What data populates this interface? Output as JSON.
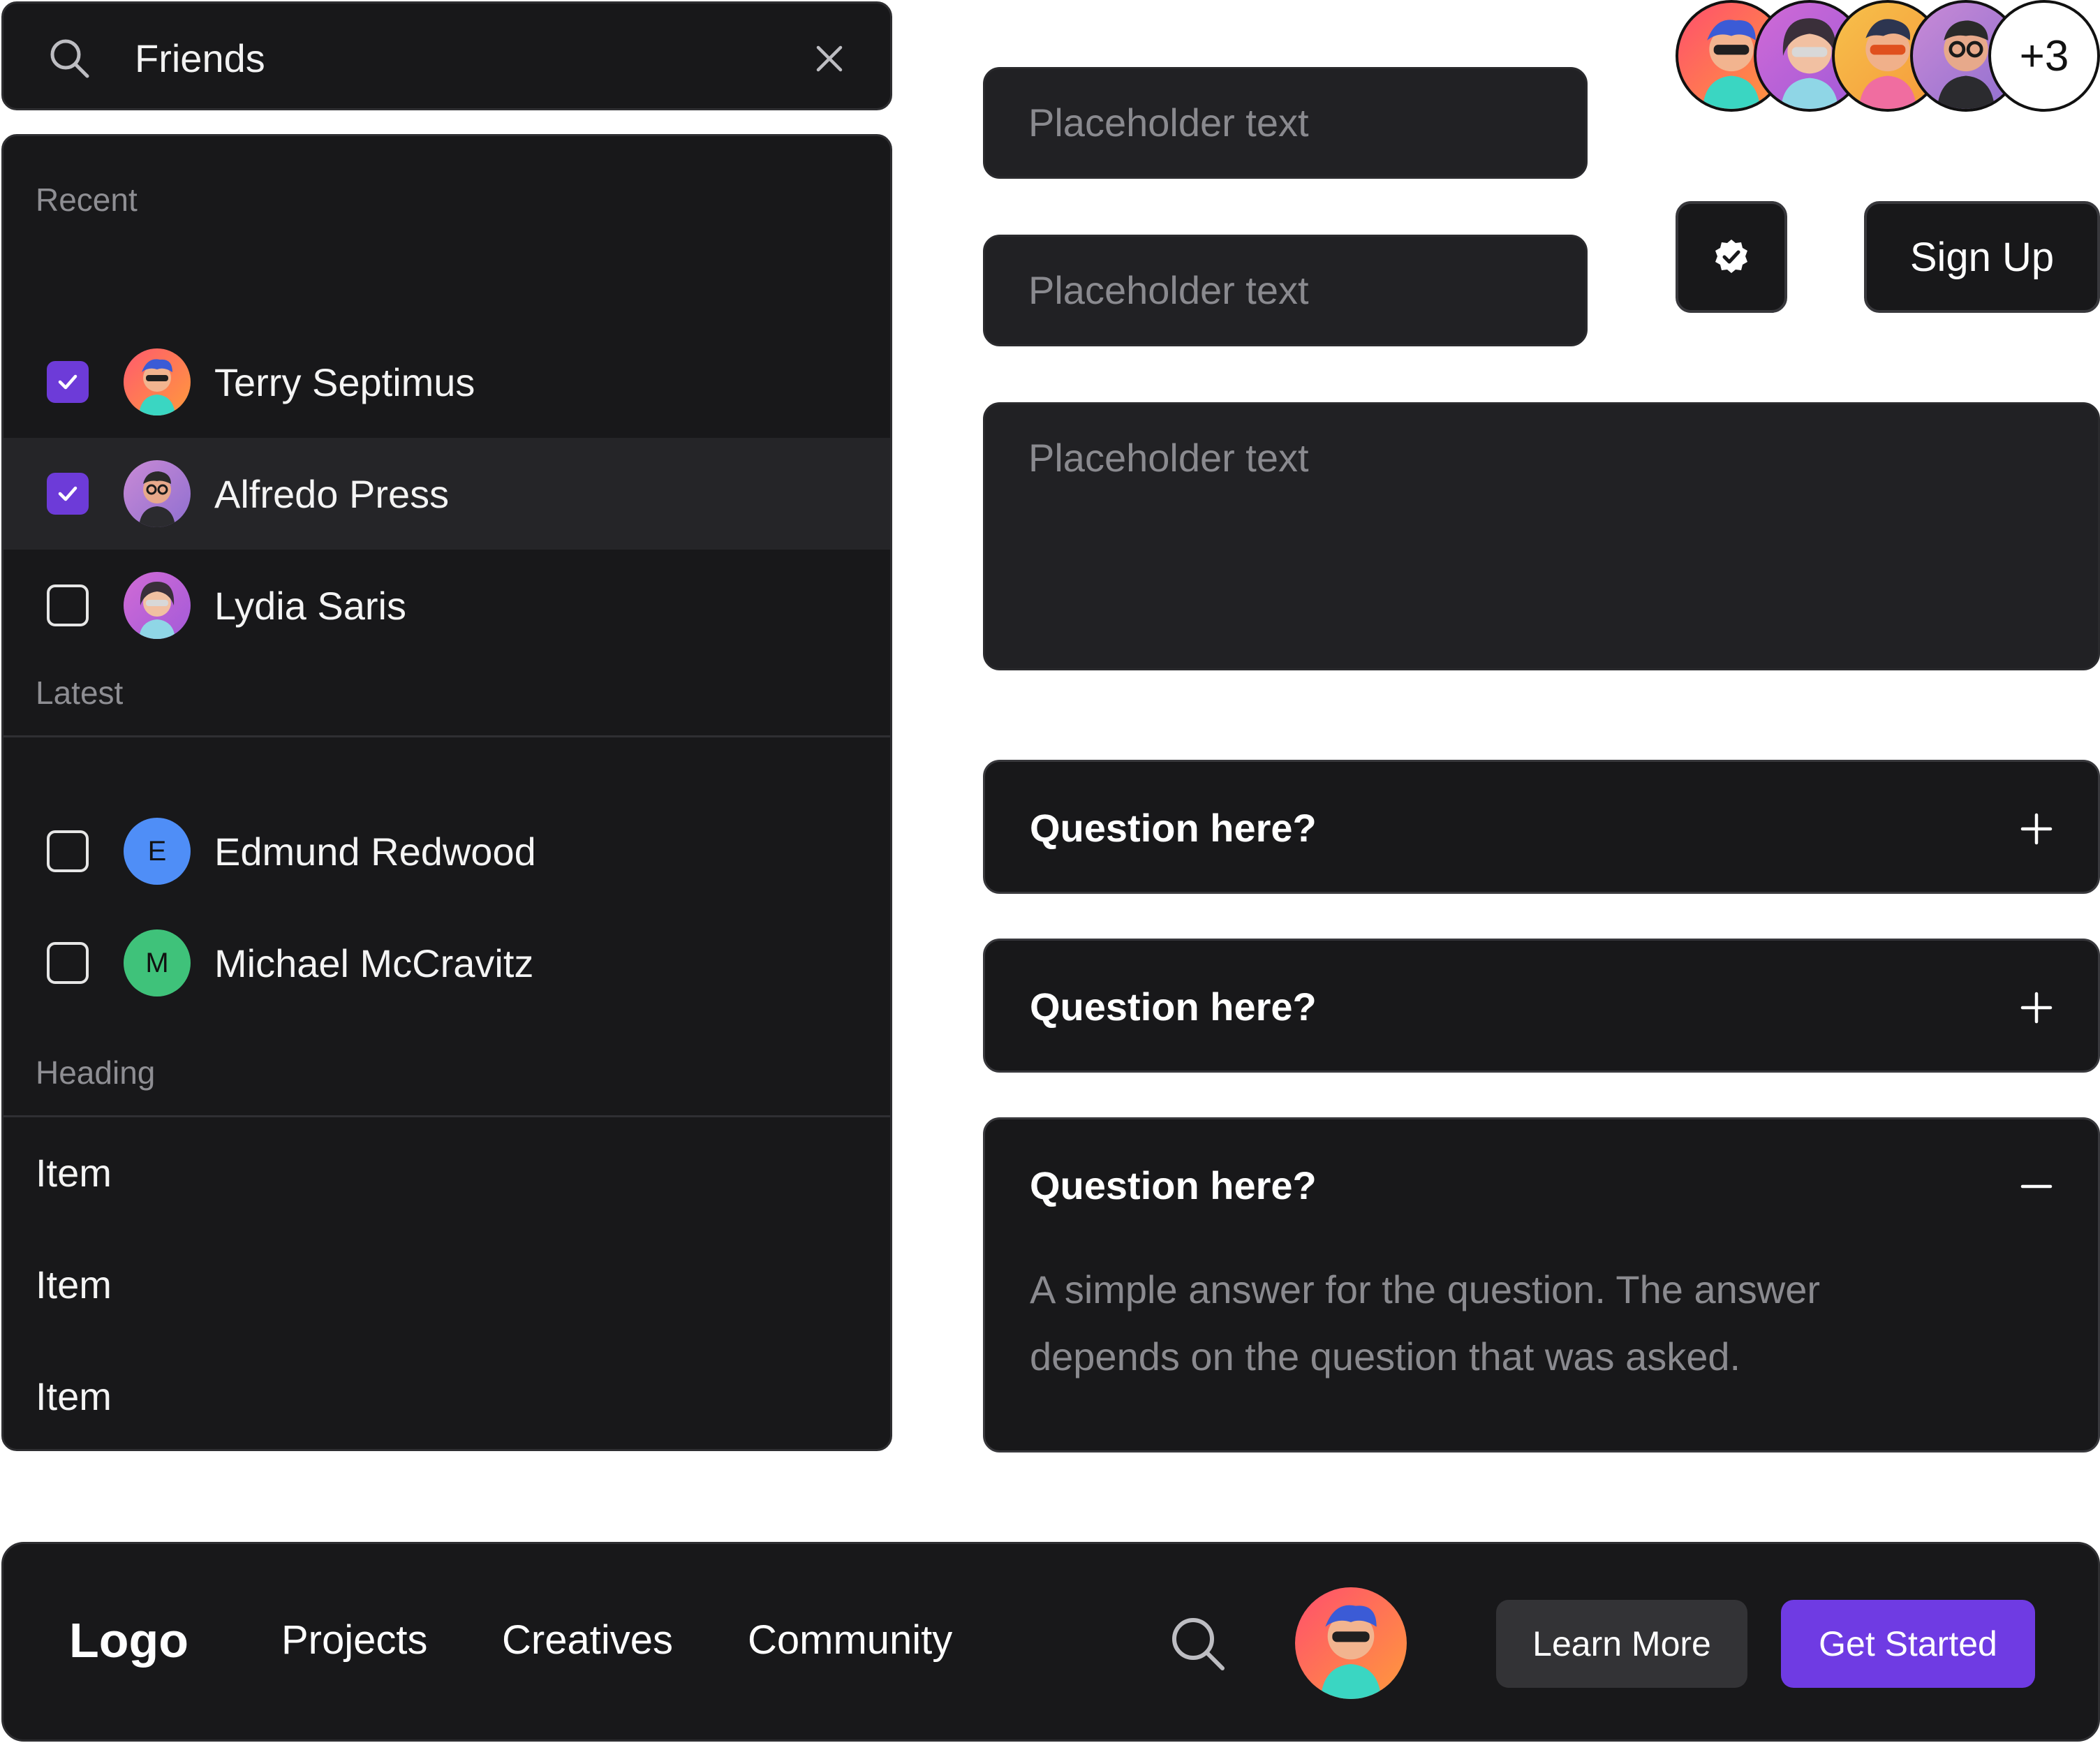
{
  "search": {
    "value": "Friends"
  },
  "list": {
    "sections": [
      {
        "label": "Recent",
        "rows": [
          {
            "name": "Terry Septimus",
            "checked": true
          },
          {
            "name": "Alfredo Press",
            "checked": true,
            "highlighted": true
          },
          {
            "name": "Lydia Saris",
            "checked": false
          }
        ]
      },
      {
        "label": "Latest",
        "rows": [
          {
            "name": "Edmund Redwood",
            "initial": "E",
            "checked": false
          },
          {
            "name": "Michael McCravitz",
            "initial": "M",
            "checked": false
          }
        ]
      },
      {
        "label": "Heading",
        "items": [
          "Item",
          "Item",
          "Item"
        ]
      }
    ]
  },
  "form": {
    "field1_placeholder": "Placeholder text",
    "field2_placeholder": "Placeholder text",
    "textarea_placeholder": "Placeholder text"
  },
  "avatar_group": {
    "more_label": "+3"
  },
  "buttons": {
    "signup_label": "Sign Up",
    "icon_button_icon": "verified-badge-icon"
  },
  "accordion": [
    {
      "question": "Question here?",
      "expanded": false
    },
    {
      "question": "Question here?",
      "expanded": false
    },
    {
      "question": "Question here?",
      "expanded": true,
      "answer": "A simple answer for the question. The answer depends on the question that was asked."
    }
  ],
  "navbar": {
    "logo": "Logo",
    "links": [
      "Projects",
      "Creatives",
      "Community"
    ],
    "learn_more_label": "Learn More",
    "get_started_label": "Get Started"
  },
  "colors": {
    "accent": "#6d3bd8",
    "panel": "#18181a",
    "field": "#212124",
    "muted_text": "#8e8e93",
    "initial_e": "#4f8ef7",
    "initial_m": "#3fc27a"
  }
}
